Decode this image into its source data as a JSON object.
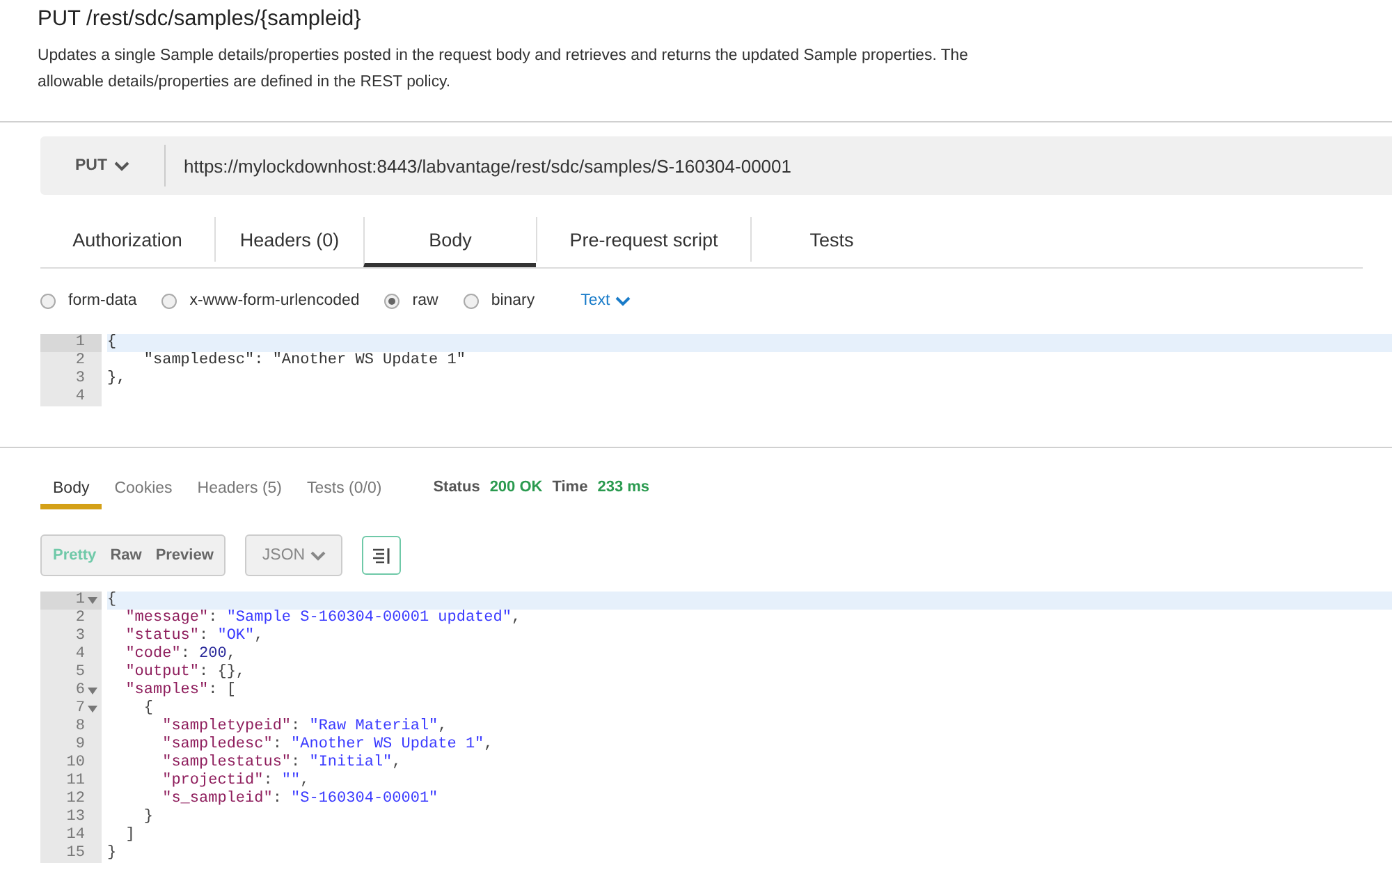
{
  "endpoint": {
    "title": "PUT /rest/sdc/samples/{sampleid}",
    "description": "Updates a single Sample details/properties posted in the request body and retrieves and returns the updated Sample properties. The allowable details/properties are defined in the REST policy."
  },
  "request": {
    "method": "PUT",
    "url": "https://mylockdownhost:8443/labvantage/rest/sdc/samples/S-160304-00001",
    "tabs": [
      {
        "label": "Authorization",
        "selected": false
      },
      {
        "label": "Headers (0)",
        "selected": false
      },
      {
        "label": "Body",
        "selected": true
      },
      {
        "label": "Pre-request script",
        "selected": false
      },
      {
        "label": "Tests",
        "selected": false
      }
    ],
    "body_types": [
      {
        "label": "form-data",
        "selected": false
      },
      {
        "label": "x-www-form-urlencoded",
        "selected": false
      },
      {
        "label": "raw",
        "selected": true
      },
      {
        "label": "binary",
        "selected": false
      }
    ],
    "format": "Text",
    "editor": [
      {
        "number": "1",
        "active": true,
        "text": "{"
      },
      {
        "number": "2",
        "active": false,
        "text": "    \"sampledesc\": \"Another WS Update 1\""
      },
      {
        "number": "3",
        "active": false,
        "text": "},"
      },
      {
        "number": "4",
        "active": false
      }
    ]
  },
  "response": {
    "tabs": [
      {
        "label": "Body",
        "selected": true
      },
      {
        "label": "Cookies",
        "selected": false
      },
      {
        "label": "Headers (5)",
        "selected": false
      },
      {
        "label": "Tests (0/0)",
        "selected": false
      }
    ],
    "status_label": "Status",
    "status": "200 OK",
    "time_label": "Time",
    "time": "233 ms",
    "views": [
      {
        "label": "Pretty",
        "selected": true
      },
      {
        "label": "Raw",
        "selected": false
      },
      {
        "label": "Preview",
        "selected": false
      }
    ],
    "format": "JSON",
    "lines": [
      {
        "number": "1",
        "fold": true,
        "active": true,
        "tokens": [
          {
            "kind": "punct",
            "text": "{"
          }
        ]
      },
      {
        "number": "2",
        "fold": false,
        "active": false,
        "tokens": [
          {
            "kind": "key",
            "text": "  \"message\""
          },
          {
            "kind": "punct",
            "text": ": "
          },
          {
            "kind": "string",
            "text": "\"Sample S-160304-00001 updated\""
          },
          {
            "kind": "punct",
            "text": ","
          }
        ]
      },
      {
        "number": "3",
        "fold": false,
        "active": false,
        "tokens": [
          {
            "kind": "key",
            "text": "  \"status\""
          },
          {
            "kind": "punct",
            "text": ": "
          },
          {
            "kind": "string",
            "text": "\"OK\""
          },
          {
            "kind": "punct",
            "text": ","
          }
        ]
      },
      {
        "number": "4",
        "fold": false,
        "active": false,
        "tokens": [
          {
            "kind": "key",
            "text": "  \"code\""
          },
          {
            "kind": "punct",
            "text": ": "
          },
          {
            "kind": "number",
            "text": "200"
          },
          {
            "kind": "punct",
            "text": ","
          }
        ]
      },
      {
        "number": "5",
        "fold": false,
        "active": false,
        "tokens": [
          {
            "kind": "key",
            "text": "  \"output\""
          },
          {
            "kind": "punct",
            "text": ": {},"
          }
        ]
      },
      {
        "number": "6",
        "fold": true,
        "active": false,
        "tokens": [
          {
            "kind": "key",
            "text": "  \"samples\""
          },
          {
            "kind": "punct",
            "text": ": ["
          }
        ]
      },
      {
        "number": "7",
        "fold": true,
        "active": false,
        "tokens": [
          {
            "kind": "punct",
            "text": "    {"
          }
        ]
      },
      {
        "number": "8",
        "fold": false,
        "active": false,
        "tokens": [
          {
            "kind": "key",
            "text": "      \"sampletypeid\""
          },
          {
            "kind": "punct",
            "text": ": "
          },
          {
            "kind": "string",
            "text": "\"Raw Material\""
          },
          {
            "kind": "punct",
            "text": ","
          }
        ]
      },
      {
        "number": "9",
        "fold": false,
        "active": false,
        "tokens": [
          {
            "kind": "key",
            "text": "      \"sampledesc\""
          },
          {
            "kind": "punct",
            "text": ": "
          },
          {
            "kind": "string",
            "text": "\"Another WS Update 1\""
          },
          {
            "kind": "punct",
            "text": ","
          }
        ]
      },
      {
        "number": "10",
        "fold": false,
        "active": false,
        "tokens": [
          {
            "kind": "key",
            "text": "      \"samplestatus\""
          },
          {
            "kind": "punct",
            "text": ": "
          },
          {
            "kind": "string",
            "text": "\"Initial\""
          },
          {
            "kind": "punct",
            "text": ","
          }
        ]
      },
      {
        "number": "11",
        "fold": false,
        "active": false,
        "tokens": [
          {
            "kind": "key",
            "text": "      \"projectid\""
          },
          {
            "kind": "punct",
            "text": ": "
          },
          {
            "kind": "string",
            "text": "\"\""
          },
          {
            "kind": "punct",
            "text": ","
          }
        ]
      },
      {
        "number": "12",
        "fold": false,
        "active": false,
        "tokens": [
          {
            "kind": "key",
            "text": "      \"s_sampleid\""
          },
          {
            "kind": "punct",
            "text": ": "
          },
          {
            "kind": "string",
            "text": "\"S-160304-00001\""
          }
        ]
      },
      {
        "number": "13",
        "fold": false,
        "active": false,
        "tokens": [
          {
            "kind": "punct",
            "text": "    }"
          }
        ]
      },
      {
        "number": "14",
        "fold": false,
        "active": false,
        "tokens": [
          {
            "kind": "punct",
            "text": "  ]"
          }
        ]
      },
      {
        "number": "15",
        "fold": false,
        "active": false,
        "tokens": [
          {
            "kind": "punct",
            "text": "}"
          }
        ]
      }
    ]
  }
}
